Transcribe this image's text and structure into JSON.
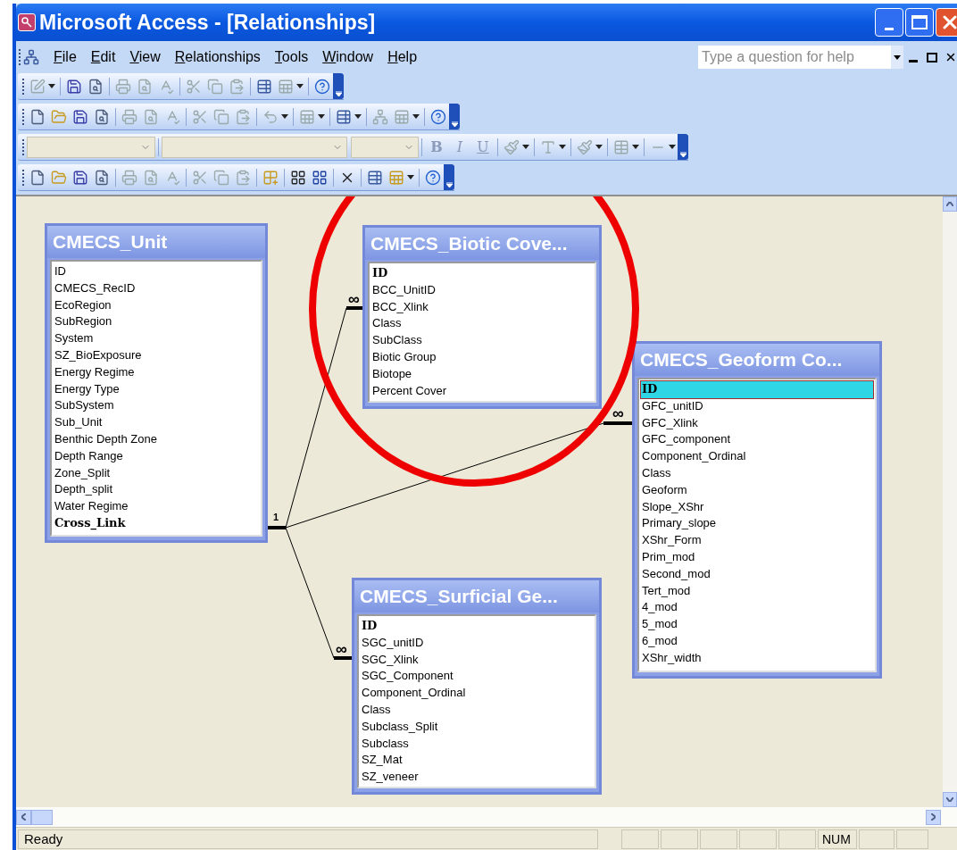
{
  "window": {
    "title": "Microsoft Access - [Relationships]"
  },
  "menu": [
    {
      "label": "File"
    },
    {
      "label": "Edit"
    },
    {
      "label": "View"
    },
    {
      "label": "Relationships"
    },
    {
      "label": "Tools"
    },
    {
      "label": "Window"
    },
    {
      "label": "Help"
    }
  ],
  "help_box": {
    "placeholder": "Type a question for help"
  },
  "format_toolbar": {
    "buttons": [
      "B",
      "I",
      "U"
    ]
  },
  "tables": [
    {
      "title": "CMECS_Unit",
      "fields": [
        {
          "name": "ID",
          "key": false,
          "selected": false
        },
        {
          "name": "CMECS_RecID",
          "key": false,
          "selected": false
        },
        {
          "name": "EcoRegion",
          "key": false,
          "selected": false
        },
        {
          "name": "SubRegion",
          "key": false,
          "selected": false
        },
        {
          "name": "System",
          "key": false,
          "selected": false
        },
        {
          "name": "SZ_BioExposure",
          "key": false,
          "selected": false
        },
        {
          "name": "Energy Regime",
          "key": false,
          "selected": false
        },
        {
          "name": "Energy Type",
          "key": false,
          "selected": false
        },
        {
          "name": "SubSystem",
          "key": false,
          "selected": false
        },
        {
          "name": "Sub_Unit",
          "key": false,
          "selected": false
        },
        {
          "name": "Benthic Depth Zone",
          "key": false,
          "selected": false
        },
        {
          "name": "Depth Range",
          "key": false,
          "selected": false
        },
        {
          "name": "Zone_Split",
          "key": false,
          "selected": false
        },
        {
          "name": "Depth_split",
          "key": false,
          "selected": false
        },
        {
          "name": "Water Regime",
          "key": false,
          "selected": false
        },
        {
          "name": "Cross_Link",
          "key": true,
          "selected": false
        }
      ]
    },
    {
      "title": "CMECS_Biotic Cove...",
      "fields": [
        {
          "name": "ID",
          "key": true,
          "selected": false
        },
        {
          "name": "BCC_UnitID",
          "key": false,
          "selected": false
        },
        {
          "name": "BCC_Xlink",
          "key": false,
          "selected": false
        },
        {
          "name": "Class",
          "key": false,
          "selected": false
        },
        {
          "name": "SubClass",
          "key": false,
          "selected": false
        },
        {
          "name": "Biotic Group",
          "key": false,
          "selected": false
        },
        {
          "name": "Biotope",
          "key": false,
          "selected": false
        },
        {
          "name": "Percent Cover",
          "key": false,
          "selected": false
        }
      ]
    },
    {
      "title": "CMECS_Geoform Co...",
      "fields": [
        {
          "name": "ID",
          "key": true,
          "selected": true
        },
        {
          "name": "GFC_unitID",
          "key": false,
          "selected": false
        },
        {
          "name": "GFC_Xlink",
          "key": false,
          "selected": false
        },
        {
          "name": "GFC_component",
          "key": false,
          "selected": false
        },
        {
          "name": "Component_Ordinal",
          "key": false,
          "selected": false
        },
        {
          "name": "Class",
          "key": false,
          "selected": false
        },
        {
          "name": "Geoform",
          "key": false,
          "selected": false
        },
        {
          "name": "Slope_XShr",
          "key": false,
          "selected": false
        },
        {
          "name": "Primary_slope",
          "key": false,
          "selected": false
        },
        {
          "name": "XShr_Form",
          "key": false,
          "selected": false
        },
        {
          "name": "Prim_mod",
          "key": false,
          "selected": false
        },
        {
          "name": "Second_mod",
          "key": false,
          "selected": false
        },
        {
          "name": "Tert_mod",
          "key": false,
          "selected": false
        },
        {
          "name": "4_mod",
          "key": false,
          "selected": false
        },
        {
          "name": "5_mod",
          "key": false,
          "selected": false
        },
        {
          "name": "6_mod",
          "key": false,
          "selected": false
        },
        {
          "name": "XShr_width",
          "key": false,
          "selected": false
        }
      ]
    },
    {
      "title": "CMECS_Surficial Ge...",
      "fields": [
        {
          "name": "ID",
          "key": true,
          "selected": false
        },
        {
          "name": "SGC_unitID",
          "key": false,
          "selected": false
        },
        {
          "name": "SGC_Xlink",
          "key": false,
          "selected": false
        },
        {
          "name": "SGC_Component",
          "key": false,
          "selected": false
        },
        {
          "name": "Component_Ordinal",
          "key": false,
          "selected": false
        },
        {
          "name": "Class",
          "key": false,
          "selected": false
        },
        {
          "name": "Subclass_Split",
          "key": false,
          "selected": false
        },
        {
          "name": "Subclass",
          "key": false,
          "selected": false
        },
        {
          "name": "SZ_Mat",
          "key": false,
          "selected": false
        },
        {
          "name": "SZ_veneer",
          "key": false,
          "selected": false
        }
      ]
    }
  ],
  "relationships": {
    "one_label": "1",
    "joins": [
      {
        "many_label": "∞"
      },
      {
        "many_label": "∞"
      },
      {
        "many_label": "∞"
      }
    ]
  },
  "status_bar": {
    "message": "Ready",
    "num_lock": "NUM"
  }
}
